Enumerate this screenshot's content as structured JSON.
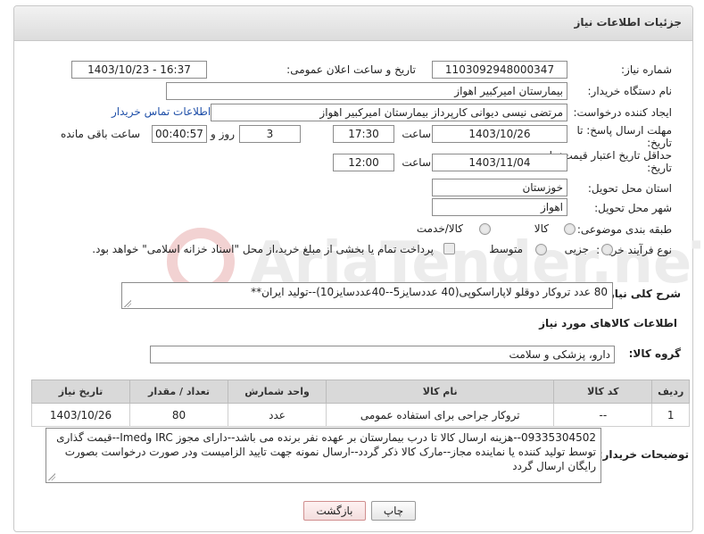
{
  "header": {
    "title": "جزئیات اطلاعات نیاز"
  },
  "fields": {
    "need_number_label": "شماره نیاز:",
    "need_number": "1103092948000347",
    "announce_label": "تاریخ و ساعت اعلان عمومی:",
    "announce_value": "1403/10/23 - 16:37",
    "buyer_org_label": "نام دستگاه خریدار:",
    "buyer_org": "بیمارستان امیرکبیر اهواز",
    "requester_label": "ایجاد کننده درخواست:",
    "requester": "مرتضی نیسی دیوانی کارپرداز بیمارستان امیرکبیر اهواز",
    "buyer_contact_link": "اطلاعات تماس خریدار",
    "deadline_label_1": "مهلت ارسال پاسخ: تا",
    "deadline_label_2": "تاریخ:",
    "deadline_date": "1403/10/26",
    "time_label": "ساعت",
    "deadline_time": "17:30",
    "days_value": "3",
    "days_and_label": "روز و",
    "remaining_time": "00:40:57",
    "remaining_label": "ساعت باقی مانده",
    "validity_label_1": "حداقل تاریخ اعتبار قیمت: تا",
    "validity_label_2": "تاریخ:",
    "validity_date": "1403/11/04",
    "validity_time": "12:00",
    "province_label": "استان محل تحویل:",
    "province": "خوزستان",
    "city_label": "شهر محل تحویل:",
    "city": "اهواز",
    "category_label": "طبقه بندی موضوعی:",
    "category_options": [
      "کالا",
      "کالا/خدمت"
    ],
    "process_label": "نوع فرآیند خرید :",
    "process_options": [
      "جزیی",
      "متوسط"
    ],
    "payment_note": "پرداخت تمام یا بخشی از مبلغ خرید،از محل \"اسناد خزانه اسلامی\" خواهد بود."
  },
  "description": {
    "label": "شرح کلی نیاز:",
    "text": "80 عدد تروکار دوقلو لاپاراسکوپی(40 عددسایز5--40عددسایز10)--تولید ایران**"
  },
  "goods_info_title": "اطلاعات کالاهای مورد نیاز",
  "goods_group": {
    "label": "گروه کالا:",
    "value": "دارو، پزشکی و سلامت"
  },
  "table": {
    "headers": [
      "ردیف",
      "کد کالا",
      "نام کالا",
      "واحد شمارش",
      "تعداد / مقدار",
      "تاریخ نیاز"
    ],
    "rows": [
      [
        "1",
        "--",
        "تروکار جراحی برای استفاده عمومی",
        "عدد",
        "80",
        "1403/10/26"
      ]
    ]
  },
  "buyer_notes": {
    "label": "توضیحات خریدار:",
    "text": "09335304502--هزینه ارسال کالا تا درب بیمارستان بر عهده نفر برنده می باشد--دارای مجوز IRC وImed--قیمت گذاری توسط تولید کننده یا نماینده مجاز--مارک کالا ذکر گردد--ارسال نمونه جهت تایید الزامیست ودر صورت درخواست بصورت رایگان ارسال گردد"
  },
  "buttons": {
    "print": "چاپ",
    "back": "بازگشت"
  },
  "watermark": {
    "text": "AriaTender.neT"
  }
}
